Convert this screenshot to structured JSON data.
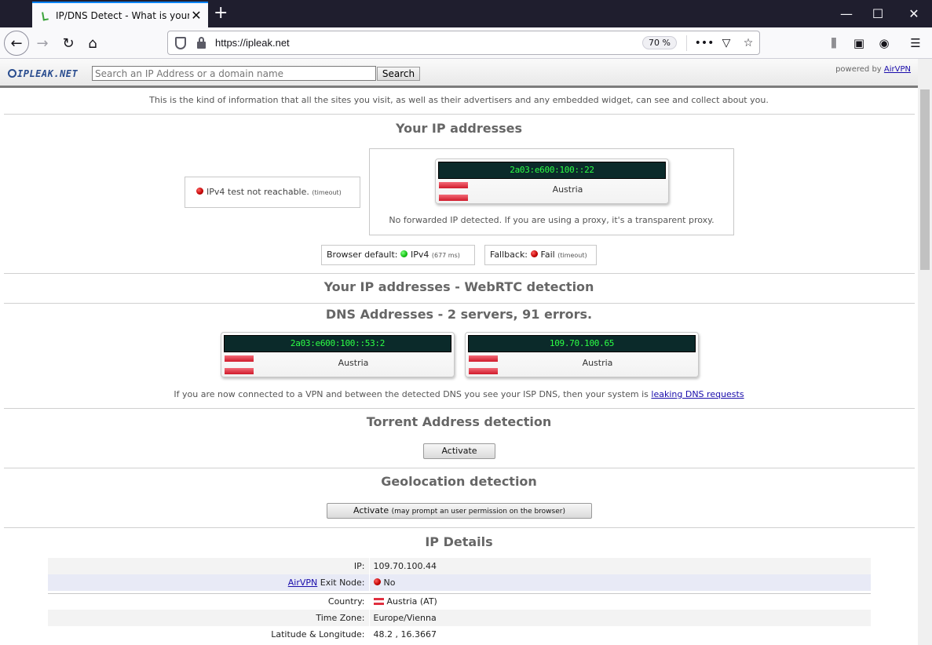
{
  "browser": {
    "tab_title": "IP/DNS Detect - What is your IP",
    "url": "https://ipleak.net",
    "zoom": "70 %",
    "more_label": "•••"
  },
  "site": {
    "logo": "IPLEAK.NET",
    "search_placeholder": "Search an IP Address or a domain name",
    "search_button": "Search",
    "powered_prefix": "powered by",
    "powered_link": "AirVPN",
    "intro": "This is the kind of information that all the sites you visit, as well as their advertisers and any embedded widget, can see and collect about you."
  },
  "ip_section": {
    "title": "Your IP addresses",
    "ipv4_status": "IPv4 test not reachable.",
    "ipv4_note": "(timeout)",
    "ipv6_address": "2a03:e600:100::22",
    "ipv6_country": "Austria",
    "forwarded_note": "No forwarded IP detected. If you are using a proxy, it's a transparent proxy.",
    "browser_default_label": "Browser default:",
    "browser_default_value": "IPv4",
    "browser_default_ms": "(677 ms)",
    "fallback_label": "Fallback:",
    "fallback_value": "Fail",
    "fallback_note": "(timeout)"
  },
  "webrtc_section": {
    "title": "Your IP addresses - WebRTC detection"
  },
  "dns_section": {
    "title": "DNS Addresses - 2 servers, 91 errors.",
    "servers": [
      {
        "ip": "2a03:e600:100::53:2",
        "country": "Austria"
      },
      {
        "ip": "109.70.100.65",
        "country": "Austria"
      }
    ],
    "note_prefix": "If you are now connected to a VPN and between the detected DNS you see your ISP DNS, then your system is",
    "note_link": "leaking DNS requests"
  },
  "torrent_section": {
    "title": "Torrent Address detection",
    "button": "Activate"
  },
  "geo_section": {
    "title": "Geolocation detection",
    "button": "Activate",
    "button_note": "(may prompt an user permission on the browser)"
  },
  "details_section": {
    "title": "IP Details",
    "rows": {
      "ip_label": "IP:",
      "ip_value": "109.70.100.44",
      "exit_link": "AirVPN",
      "exit_label": "Exit Node:",
      "exit_value": "No",
      "country_label": "Country:",
      "country_value": "Austria (AT)",
      "tz_label": "Time Zone:",
      "tz_value": "Europe/Vienna",
      "latlon_label": "Latitude & Longitude:",
      "latlon_value": "48.2 , 16.3667"
    }
  }
}
